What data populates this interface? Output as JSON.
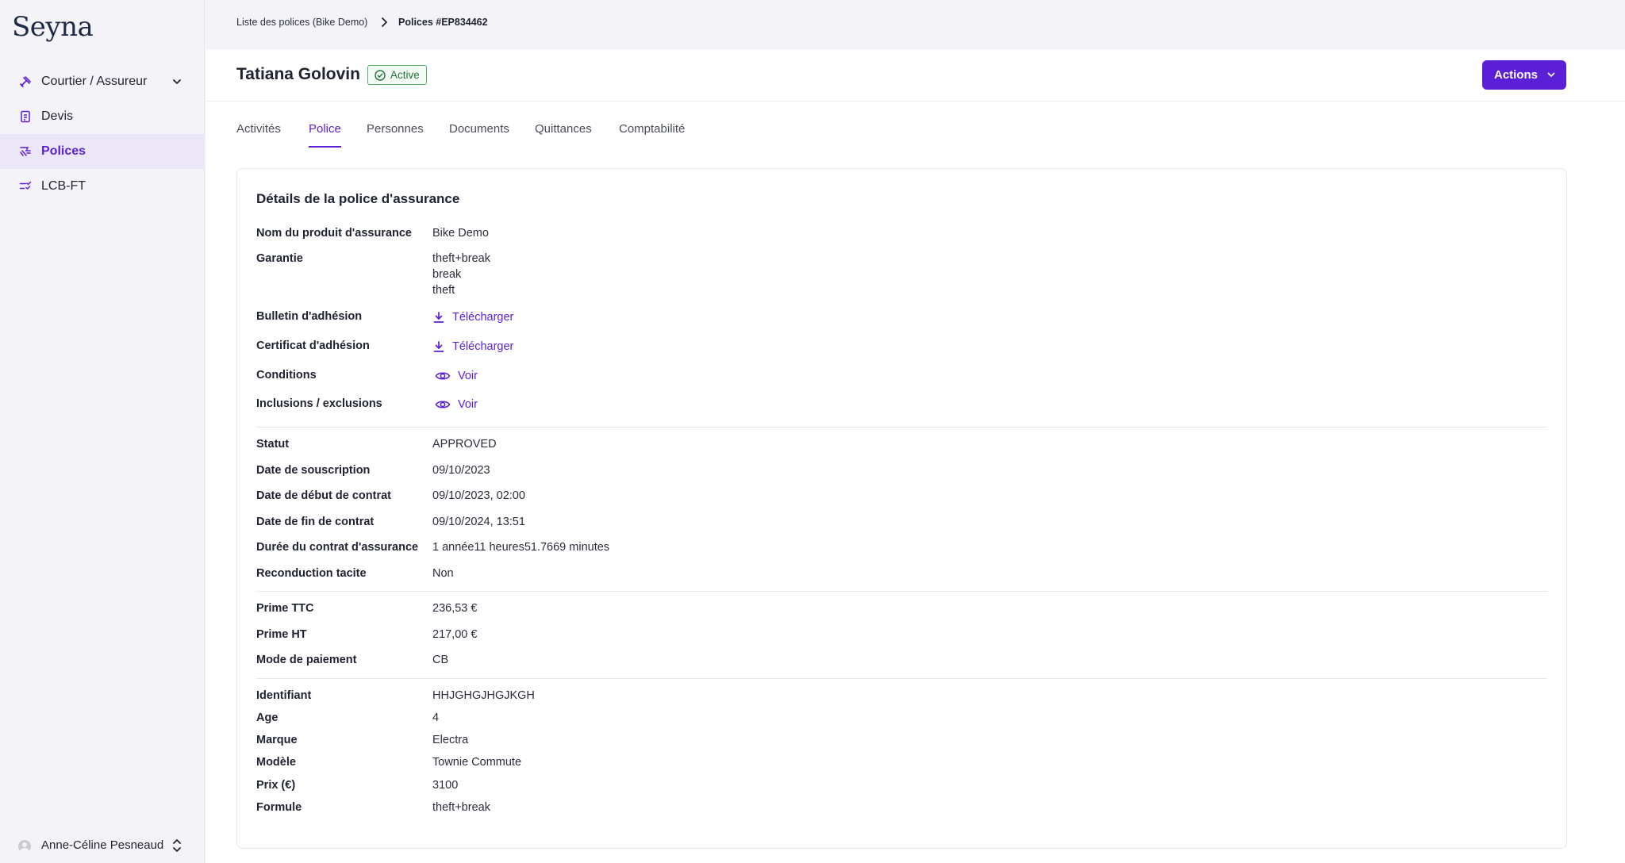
{
  "app": {
    "logo": "Seyna"
  },
  "sidebar": {
    "items": [
      {
        "label": "Courtier / Assureur",
        "icon": "broker-icon"
      },
      {
        "label": "Devis",
        "icon": "document-icon"
      },
      {
        "label": "Polices",
        "icon": "policy-icon",
        "active": true
      },
      {
        "label": "LCB-FT",
        "icon": "checklist-icon"
      }
    ],
    "user": "Anne-Céline Pesneaud"
  },
  "breadcrumb": {
    "parent": "Liste des polices (Bike Demo)",
    "current": "Polices #EP834462"
  },
  "header": {
    "title": "Tatiana Golovin",
    "status": "Active",
    "actions_label": "Actions"
  },
  "tabs": [
    "Activités",
    "Police",
    "Personnes",
    "Documents",
    "Quittances",
    "Comptabilité"
  ],
  "card": {
    "title": "Détails de la police d'assurance",
    "product": {
      "label": "Nom du produit d'assurance",
      "value": "Bike Demo"
    },
    "garantie": {
      "label": "Garantie",
      "values": [
        "theft+break",
        "break",
        "theft"
      ]
    },
    "bulletin": {
      "label": "Bulletin d'adhésion",
      "link": "Télécharger"
    },
    "certificat": {
      "label": "Certificat d'adhésion",
      "link": "Télécharger"
    },
    "conditions": {
      "label": "Conditions",
      "link": "Voir"
    },
    "inclusions": {
      "label": "Inclusions / exclusions",
      "link": "Voir"
    },
    "contract": [
      {
        "label": "Statut",
        "value": "APPROVED"
      },
      {
        "label": "Date de souscription",
        "value": "09/10/2023"
      },
      {
        "label": "Date de début de contrat",
        "value": "09/10/2023, 02:00"
      },
      {
        "label": "Date de fin de contrat",
        "value": "09/10/2024, 13:51"
      },
      {
        "label": "Durée du contrat d'assurance",
        "value": "1 année11 heures51.7669 minutes"
      },
      {
        "label": "Reconduction tacite",
        "value": "Non"
      }
    ],
    "premium": [
      {
        "label": "Prime TTC",
        "value": "236,53 €"
      },
      {
        "label": "Prime HT",
        "value": "217,00 €"
      },
      {
        "label": "Mode de paiement",
        "value": "CB"
      }
    ],
    "bike": [
      {
        "label": "Identifiant",
        "value": "HHJGHGJHGJKGH"
      },
      {
        "label": "Age",
        "value": "4"
      },
      {
        "label": "Marque",
        "value": "Electra"
      },
      {
        "label": "Modèle",
        "value": "Townie Commute"
      },
      {
        "label": "Prix (€)",
        "value": "3100"
      },
      {
        "label": "Formule",
        "value": "theft+break"
      }
    ]
  },
  "colors": {
    "accent": "#5a1fd6",
    "active_bg": "#ebe7f8",
    "status_green": "#24723a"
  }
}
